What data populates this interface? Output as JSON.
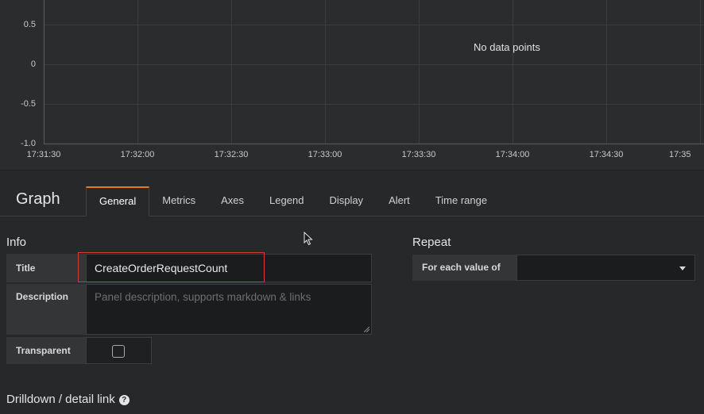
{
  "graph": {
    "y_ticks": [
      "0.5",
      "0",
      "-0.5",
      "-1.0"
    ],
    "x_ticks": [
      "17:31:30",
      "17:32:00",
      "17:32:30",
      "17:33:00",
      "17:33:30",
      "17:34:00",
      "17:34:30",
      "17:35"
    ],
    "no_data_text": "No data points"
  },
  "editor": {
    "panel_type": "Graph",
    "tabs": [
      "General",
      "Metrics",
      "Axes",
      "Legend",
      "Display",
      "Alert",
      "Time range"
    ],
    "active_tab": "General"
  },
  "info": {
    "heading": "Info",
    "title_label": "Title",
    "title_value": "CreateOrderRequestCount",
    "description_label": "Description",
    "description_placeholder": "Panel description, supports markdown & links",
    "transparent_label": "Transparent",
    "transparent_checked": false
  },
  "repeat": {
    "heading": "Repeat",
    "for_each_label": "For each value of",
    "for_each_value": ""
  },
  "drilldown": {
    "heading": "Drilldown / detail link"
  },
  "icons": {
    "help": "question-circle-icon",
    "dropdown": "caret-down-icon",
    "cursor": "mouse-pointer-icon"
  },
  "colors": {
    "active_tab_accent": "#eb7b18",
    "highlight_box": "#d43b3b"
  }
}
